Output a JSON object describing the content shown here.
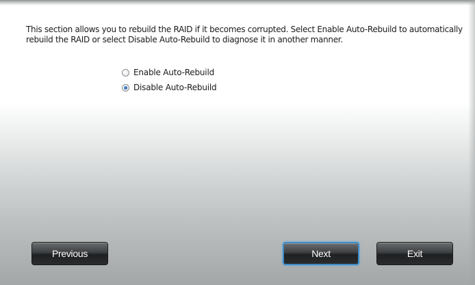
{
  "description": "This section allows you to rebuild the RAID if it becomes corrupted. Select Enable Auto-Rebuild to automatically rebuild the RAID or select Disable Auto-Rebuild to diagnose it in another manner.",
  "options": [
    {
      "label": "Enable Auto-Rebuild",
      "selected": false
    },
    {
      "label": "Disable Auto-Rebuild",
      "selected": true
    }
  ],
  "buttons": {
    "previous": "Previous",
    "next": "Next",
    "exit": "Exit"
  }
}
